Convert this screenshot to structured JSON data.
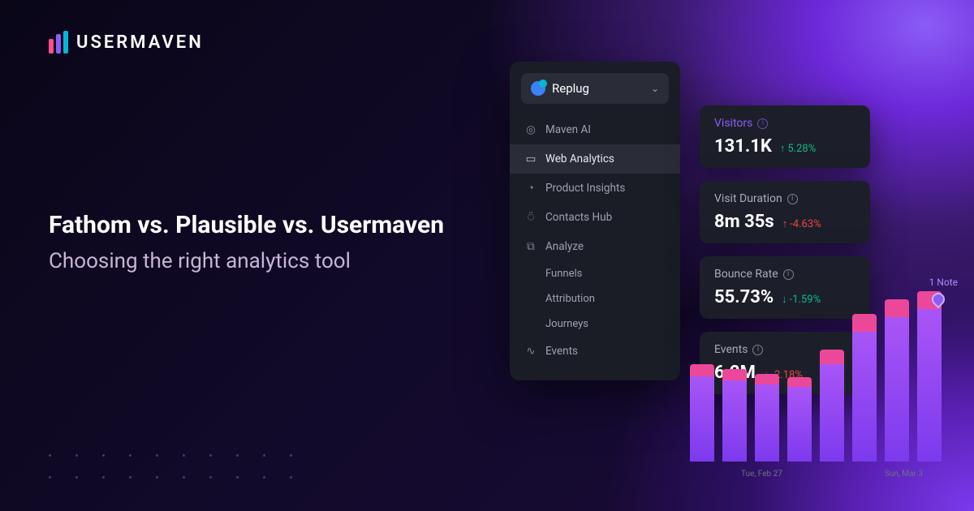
{
  "brand": {
    "name": "USERMAVEN"
  },
  "headline": {
    "title": "Fathom vs. Plausible vs. Usermaven",
    "subtitle": "Choosing the right analytics tool"
  },
  "workspace": {
    "selected": "Replug"
  },
  "nav": {
    "items": [
      {
        "icon": "target",
        "label": "Maven AI"
      },
      {
        "icon": "calendar",
        "label": "Web Analytics",
        "active": true
      },
      {
        "icon": "clock",
        "label": "Product Insights"
      },
      {
        "icon": "user",
        "label": "Contacts Hub"
      },
      {
        "icon": "chart",
        "label": "Analyze"
      }
    ],
    "sub": [
      "Funnels",
      "Attribution",
      "Journeys"
    ],
    "last": {
      "icon": "pulse",
      "label": "Events"
    }
  },
  "cards": [
    {
      "title": "Visitors",
      "value": "131.1K",
      "delta": "5.28%",
      "dir": "up",
      "highlight": true
    },
    {
      "title": "Visit Duration",
      "value": "8m 35s",
      "delta": "-4.63%",
      "dir": "down"
    },
    {
      "title": "Bounce Rate",
      "value": "55.73%",
      "delta": "-1.59%",
      "dir": "up"
    },
    {
      "title": "Events",
      "value": "6.2M",
      "delta": "-2.18%",
      "dir": "down"
    }
  ],
  "chart_data": {
    "type": "bar",
    "note_label": "1 Note",
    "x_ticks": [
      "Tue, Feb 27",
      "Sun, Mar 3"
    ],
    "series": [
      {
        "name": "main",
        "values": [
          105,
          100,
          95,
          92,
          120,
          160,
          178,
          188
        ]
      },
      {
        "name": "top",
        "values": [
          15,
          14,
          13,
          12,
          18,
          22,
          22,
          22
        ]
      }
    ]
  }
}
